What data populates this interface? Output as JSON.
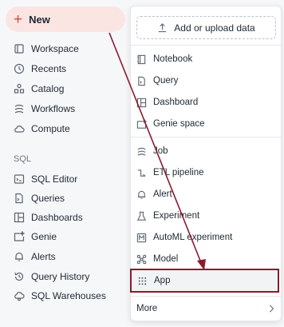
{
  "new_button": {
    "label": "New",
    "icon": "plus-icon"
  },
  "sidebar": {
    "items": [
      {
        "label": "Workspace",
        "icon": "workspace-icon"
      },
      {
        "label": "Recents",
        "icon": "clock-icon"
      },
      {
        "label": "Catalog",
        "icon": "catalog-icon"
      },
      {
        "label": "Workflows",
        "icon": "workflows-icon"
      },
      {
        "label": "Compute",
        "icon": "cloud-icon"
      }
    ],
    "sql_section_label": "SQL",
    "sql_items": [
      {
        "label": "SQL Editor",
        "icon": "sql-editor-icon"
      },
      {
        "label": "Queries",
        "icon": "query-icon"
      },
      {
        "label": "Dashboards",
        "icon": "dashboard-icon"
      },
      {
        "label": "Genie",
        "icon": "genie-icon"
      },
      {
        "label": "Alerts",
        "icon": "bell-icon"
      },
      {
        "label": "Query History",
        "icon": "history-icon"
      },
      {
        "label": "SQL Warehouses",
        "icon": "warehouse-icon"
      }
    ]
  },
  "dropdown": {
    "upload_label": "Add or upload data",
    "items": [
      {
        "label": "Notebook",
        "icon": "notebook-icon"
      },
      {
        "label": "Query",
        "icon": "query-icon"
      },
      {
        "label": "Dashboard",
        "icon": "dashboard-icon"
      },
      {
        "label": "Genie space",
        "icon": "genie-icon"
      },
      {
        "label": "Job",
        "icon": "job-icon"
      },
      {
        "label": "ETL pipeline",
        "icon": "pipeline-icon"
      },
      {
        "label": "Alert",
        "icon": "bell-icon"
      },
      {
        "label": "Experiment",
        "icon": "flask-icon"
      },
      {
        "label": "AutoML experiment",
        "icon": "automl-icon"
      },
      {
        "label": "Model",
        "icon": "model-icon"
      },
      {
        "label": "App",
        "icon": "app-grid-icon"
      }
    ],
    "more_label": "More",
    "highlighted_item": "App"
  },
  "colors": {
    "accent_red": "#d4493a",
    "highlight_border": "#8b1a2e",
    "arrow": "#8b1a2e"
  }
}
